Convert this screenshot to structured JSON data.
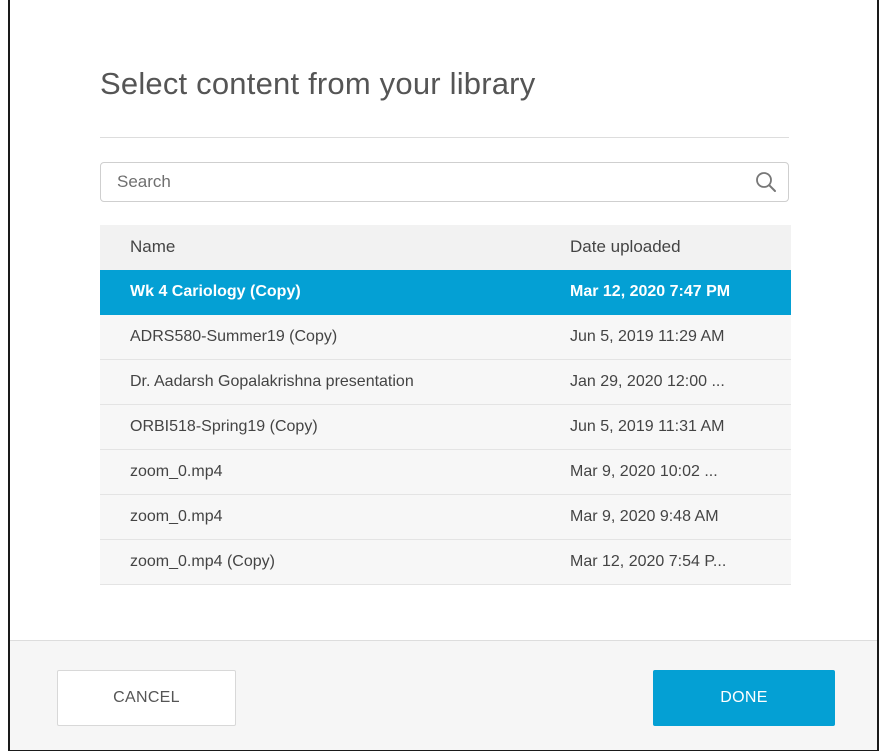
{
  "dialog": {
    "title": "Select content from your library"
  },
  "search": {
    "placeholder": "Search",
    "value": ""
  },
  "table": {
    "columns": {
      "name": "Name",
      "date": "Date uploaded"
    },
    "rows": [
      {
        "name": "Wk 4 Cariology  (Copy)",
        "date": "Mar 12, 2020 7:47 PM",
        "selected": true
      },
      {
        "name": "ADRS580-Summer19 (Copy)",
        "date": "Jun 5, 2019 11:29 AM",
        "selected": false
      },
      {
        "name": "Dr. Aadarsh Gopalakrishna presentation",
        "date": "Jan 29, 2020 12:00 ...",
        "selected": false
      },
      {
        "name": "ORBI518-Spring19 (Copy)",
        "date": "Jun 5, 2019 11:31 AM",
        "selected": false
      },
      {
        "name": "zoom_0.mp4",
        "date": "Mar 9, 2020 10:02 ...",
        "selected": false
      },
      {
        "name": "zoom_0.mp4",
        "date": "Mar 9, 2020 9:48 AM",
        "selected": false
      },
      {
        "name": "zoom_0.mp4 (Copy)",
        "date": "Mar 12, 2020 7:54 P...",
        "selected": false
      }
    ]
  },
  "footer": {
    "cancel_label": "CANCEL",
    "done_label": "DONE"
  },
  "colors": {
    "accent": "#04a0d4",
    "row_background": "#f7f7f7",
    "header_background": "#f2f2f2",
    "footer_background": "#f6f6f6"
  },
  "icons": {
    "search": "search-icon"
  }
}
